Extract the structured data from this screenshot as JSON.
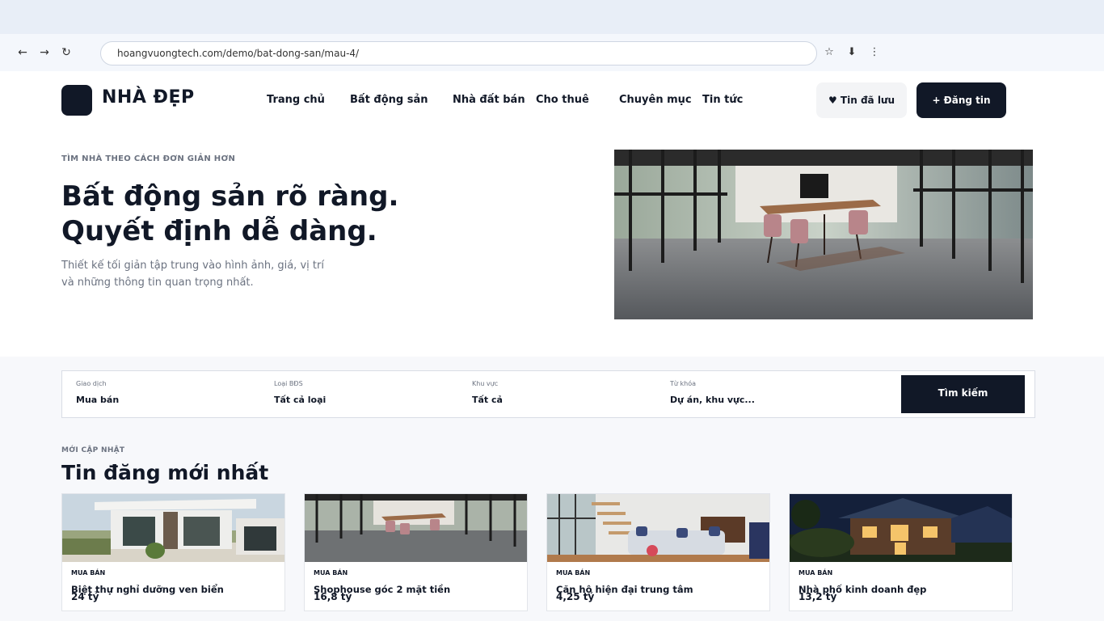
{
  "browser": {
    "back_icon": "←",
    "forward_icon": "→",
    "reload_icon": "↻",
    "url": "hoangvuongtech.com/demo/bat-dong-san/mau-4/",
    "star_icon": "☆",
    "download_icon": "⬇",
    "menu_icon": "⋮"
  },
  "header": {
    "logo_text": "NHÀ ĐẸP",
    "nav": [
      "Trang chủ",
      "Bất động sản",
      "Nhà đất bán",
      "Cho thuê",
      "Chuyên mục",
      "Tin tức"
    ],
    "saved_label": "♥ Tin đã lưu",
    "post_label": "+ Đăng tin"
  },
  "hero": {
    "eyebrow": "TÌM NHÀ THEO CÁCH ĐƠN GIẢN HƠN",
    "title_line1": "Bất động sản rõ ràng.",
    "title_line2": "Quyết định dễ dàng.",
    "subtitle_line1": "Thiết kế tối giản tập trung vào hình ảnh, giá, vị trí",
    "subtitle_line2": "và những thông tin quan trọng nhất."
  },
  "search": {
    "fields": [
      {
        "label": "Giao dịch",
        "value": "Mua bán"
      },
      {
        "label": "Loại BĐS",
        "value": "Tất cả loại"
      },
      {
        "label": "Khu vực",
        "value": "Tất cả"
      },
      {
        "label": "Từ khóa",
        "value": "Dự án, khu vực..."
      }
    ],
    "button_label": "Tìm kiếm"
  },
  "listings": {
    "eyebrow": "MỚI CẬP NHẬT",
    "title": "Tin đăng mới nhất",
    "cards": [
      {
        "tag": "MUA BÁN",
        "title": "Biệt thự nghỉ dưỡng ven biển",
        "price": "24 tỷ"
      },
      {
        "tag": "MUA BÁN",
        "title": "Shophouse góc 2 mặt tiền",
        "price": "16,8 tỷ"
      },
      {
        "tag": "MUA BÁN",
        "title": "Căn hộ hiện đại trung tâm",
        "price": "4,25 tỷ"
      },
      {
        "tag": "MUA BÁN",
        "title": "Nhà phố kinh doanh đẹp",
        "price": "13,2 tỷ"
      }
    ]
  }
}
